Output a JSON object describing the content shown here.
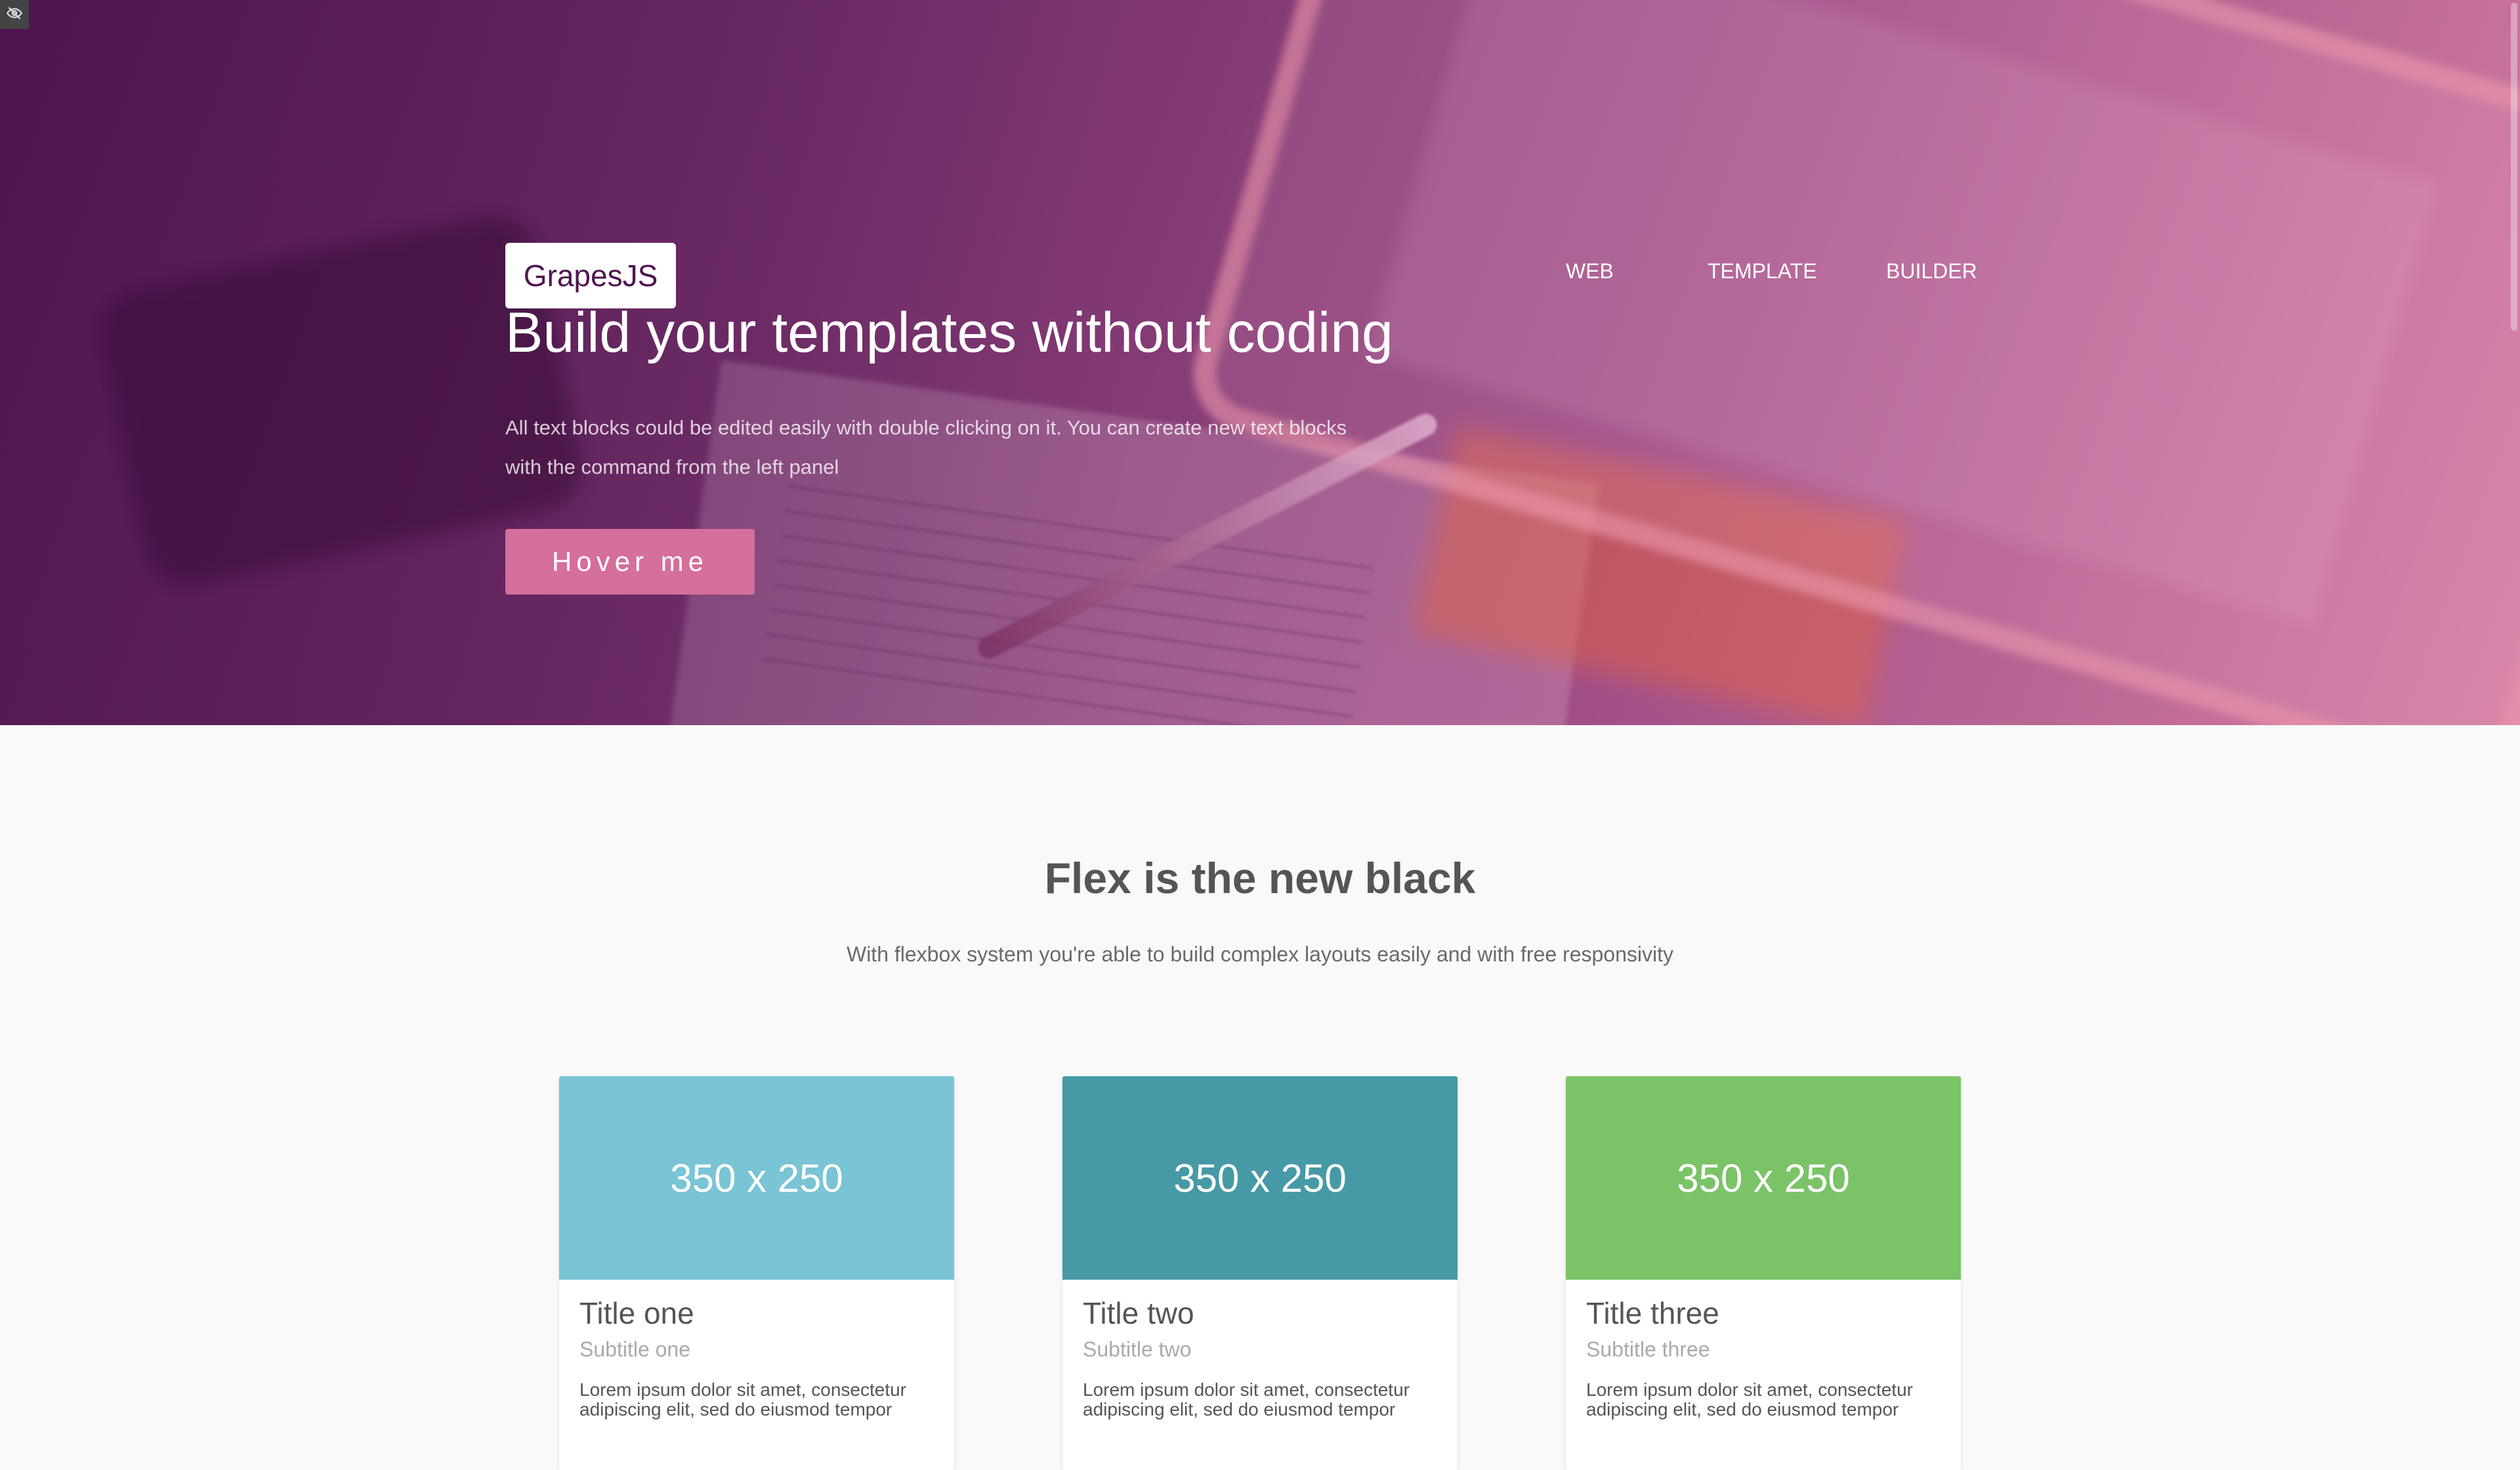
{
  "preview": {
    "icon": "eye-slash-icon"
  },
  "hero": {
    "logo_text": "GrapesJS",
    "title": "Build your templates without coding",
    "text": "All text blocks could be edited easily with double clicking on it. You can create new text blocks with the command from the left panel",
    "button_label": "Hover me",
    "nav": [
      {
        "label": "WEB"
      },
      {
        "label": "TEMPLATE"
      },
      {
        "label": "BUILDER"
      }
    ],
    "colors": {
      "gradient_start": "#4d1650",
      "gradient_end": "#d77ea4",
      "button": "#d56f9b",
      "logo_text": "#4d1650"
    }
  },
  "flex_section": {
    "title": "Flex is the new black",
    "subtitle": "With flexbox system you're able to build complex layouts easily and with free responsivity"
  },
  "cards": [
    {
      "image_label": "350 x 250",
      "image_color": "#79c4d5",
      "title": "Title one",
      "subtitle": "Subtitle one",
      "text": "Lorem ipsum dolor sit amet, consectetur adipiscing elit, sed do eiusmod tempor"
    },
    {
      "image_label": "350 x 250",
      "image_color": "#4799a6",
      "title": "Title two",
      "subtitle": "Subtitle two",
      "text": "Lorem ipsum dolor sit amet, consectetur adipiscing elit, sed do eiusmod tempor"
    },
    {
      "image_label": "350 x 250",
      "image_color": "#7ac367",
      "title": "Title three",
      "subtitle": "Subtitle three",
      "text": "Lorem ipsum dolor sit amet, consectetur adipiscing elit, sed do eiusmod tempor"
    }
  ]
}
